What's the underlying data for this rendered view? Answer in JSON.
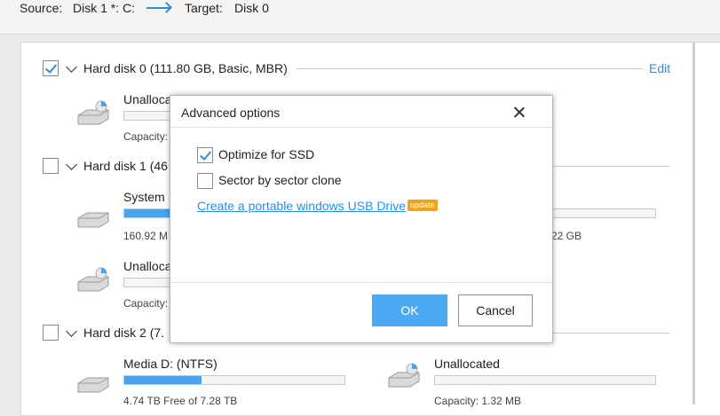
{
  "topbar": {
    "source_label": "Source:",
    "source_value": "Disk 1 *: C:",
    "target_label": "Target:",
    "target_value": "Disk 0"
  },
  "disks": [
    {
      "title": "Hard disk 0 (111.80 GB, Basic, MBR)",
      "checked": true,
      "edit_label": "Edit",
      "partitions": [
        {
          "name": "Unalloca",
          "sub": "Capacity:",
          "fill": 0
        }
      ]
    },
    {
      "title": "Hard disk 1 (46",
      "checked": false,
      "partitions": [
        {
          "name": "System",
          "sub": "160.92 M",
          "fill": 0.22
        },
        {
          "name": "",
          "sub": "22 GB",
          "fill": 0
        },
        {
          "name": "Unalloca",
          "sub": "Capacity:",
          "fill": 0
        }
      ]
    },
    {
      "title": "Hard disk 2 (7.",
      "checked": false,
      "partitions": [
        {
          "name": "Media D: (NTFS)",
          "sub": "4.74 TB Free of 7.28 TB",
          "fill": 0.35
        },
        {
          "name": "Unallocated",
          "sub": "Capacity: 1.32 MB",
          "fill": 0
        }
      ]
    }
  ],
  "modal": {
    "title": "Advanced options",
    "options": [
      {
        "label": "Optimize for SSD",
        "checked": true
      },
      {
        "label": "Sector by sector clone",
        "checked": false
      }
    ],
    "usb_link": "Create a portable windows USB Drive",
    "badge": "update",
    "ok_label": "OK",
    "cancel_label": "Cancel"
  },
  "colors": {
    "accent": "#2a8fe0",
    "ok_button": "#4aa9f1",
    "badge": "#f0a21b",
    "bar_fill": "#4aa3ef"
  },
  "icons": {
    "drive": "hard-drive-icon",
    "drive_pie": "drive-usage-pie-icon",
    "close": "close-icon",
    "chevron": "chevron-down-icon",
    "arrow": "arrow-right-icon"
  }
}
